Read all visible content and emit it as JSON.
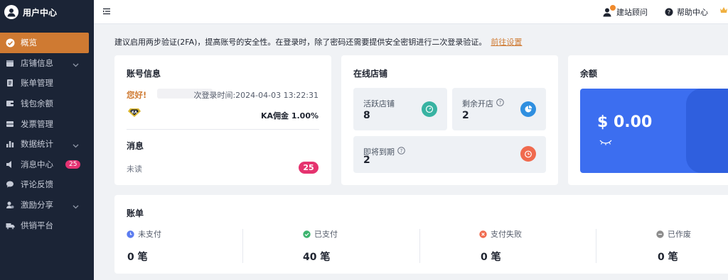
{
  "brand": {
    "title": "用户中心"
  },
  "sidebar": {
    "items": [
      {
        "label": "概览",
        "icon": "dashboard-icon",
        "active": true
      },
      {
        "label": "店铺信息",
        "icon": "store-icon",
        "chevron": true
      },
      {
        "label": "账单管理",
        "icon": "bill-icon"
      },
      {
        "label": "钱包余额",
        "icon": "wallet-icon"
      },
      {
        "label": "发票管理",
        "icon": "invoice-icon"
      },
      {
        "label": "数据统计",
        "icon": "bar-chart-icon",
        "chevron": true
      },
      {
        "label": "消息中心",
        "icon": "speaker-icon",
        "badge": "25"
      },
      {
        "label": "评论反馈",
        "icon": "comment-icon"
      },
      {
        "label": "激励分享",
        "icon": "share-icon",
        "chevron": true
      },
      {
        "label": "供销平台",
        "icon": "truck-icon"
      }
    ]
  },
  "topbar": {
    "consultant": "建站顾问",
    "help": "帮助中心"
  },
  "notice": {
    "text": "建议启用两步验证(2FA)，提高账号的安全性。在登录时，除了密码还需要提供安全密钥进行二次登录验证。",
    "link": "前往设置"
  },
  "account": {
    "title": "账号信息",
    "greeting": "您好!",
    "last_login": "次登录时间:2024-04-03 13:22:31",
    "ka_icon_text": "KA",
    "commission": "KA佣金 1.00%",
    "messages_title": "消息",
    "unread_label": "未读",
    "unread_count": "25"
  },
  "stores": {
    "title": "在线店铺",
    "tiles": [
      {
        "label": "活跃店铺",
        "value": "8",
        "color": "#38b3a2"
      },
      {
        "label": "剩余开店",
        "value": "2",
        "color": "#2f8fe0"
      },
      {
        "label": "即将到期",
        "value": "2",
        "color": "#f06a4e"
      }
    ]
  },
  "balance": {
    "title": "余额",
    "amount": "$ 0.00",
    "panel_color": "#3c6ef0"
  },
  "bills": {
    "title": "账单",
    "items": [
      {
        "label": "未支付",
        "value": "0 笔",
        "icon": "clock-icon",
        "color": "#5b7cf0"
      },
      {
        "label": "已支付",
        "value": "40 笔",
        "icon": "check-circle-icon",
        "color": "#3cb46e"
      },
      {
        "label": "支付失败",
        "value": "0 笔",
        "icon": "close-circle-icon",
        "color": "#f06a4e"
      },
      {
        "label": "已作废",
        "value": "0 笔",
        "icon": "minus-circle-icon",
        "color": "#8c8c8c"
      }
    ]
  }
}
